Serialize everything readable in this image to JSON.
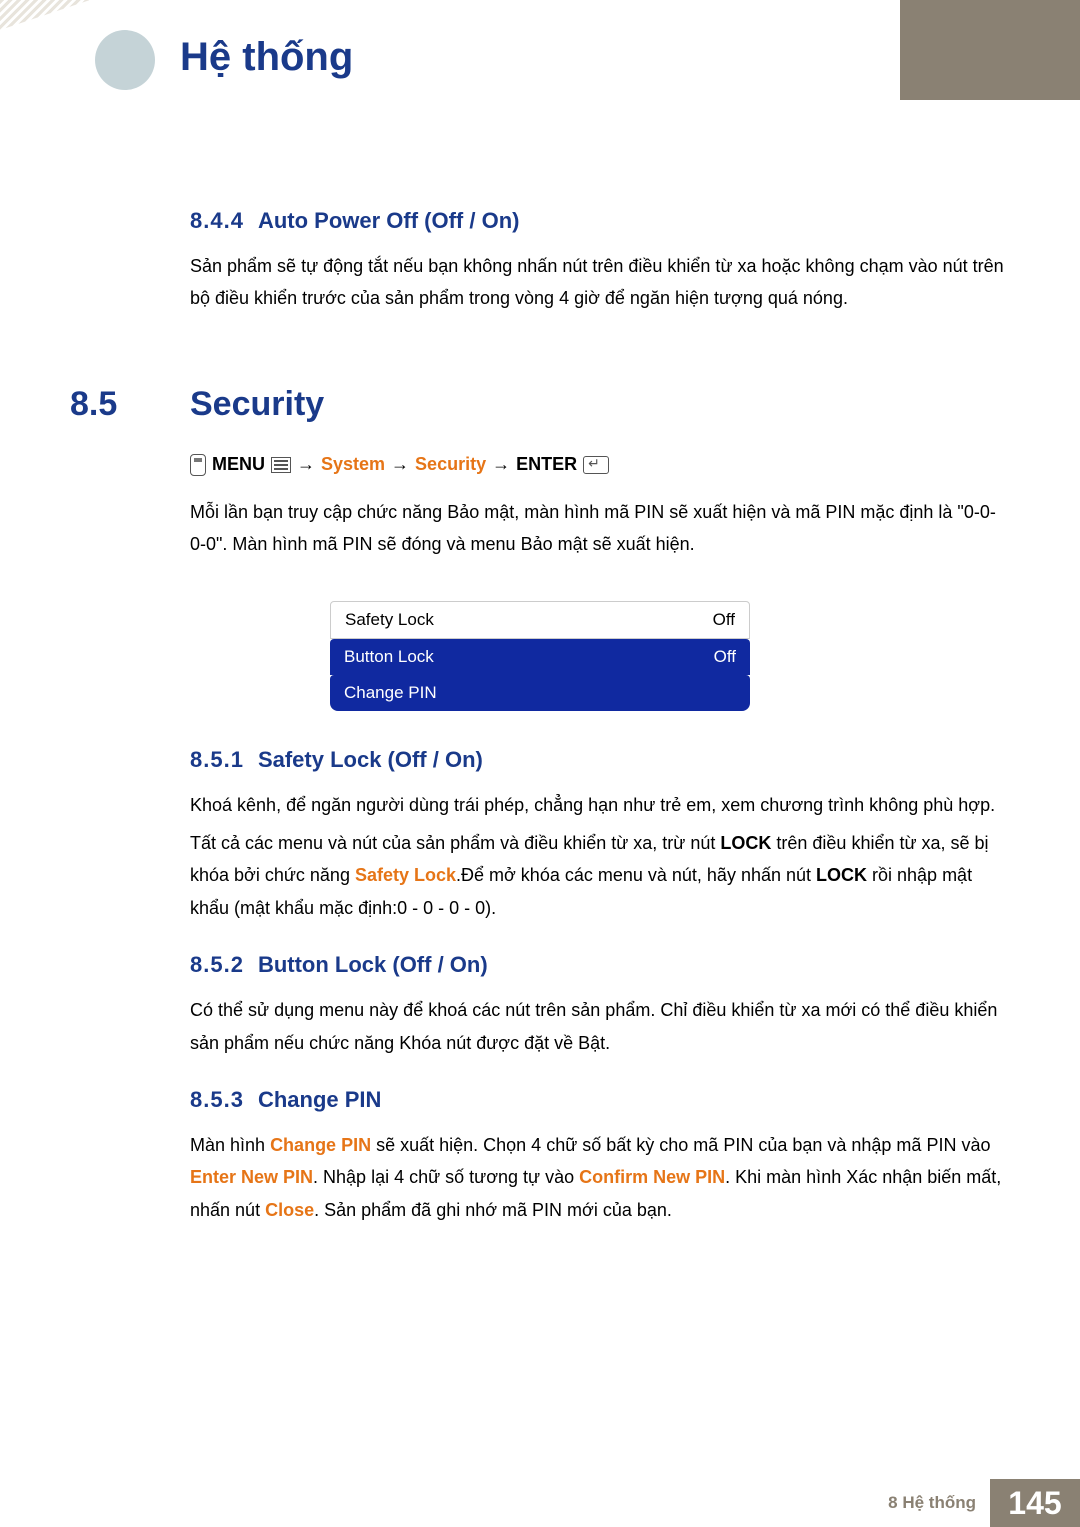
{
  "header": {
    "chapter_title": "Hệ thống"
  },
  "sections": {
    "s844": {
      "num": "8.4.4",
      "title": "Auto Power Off (Off / On)",
      "para": "Sản phẩm sẽ tự động tắt nếu bạn không nhấn nút trên điều khiển từ xa hoặc không chạm vào nút trên bộ điều khiển trước của sản phẩm trong vòng 4 giờ để ngăn hiện tượng quá nóng."
    },
    "s85": {
      "num": "8.5",
      "title": "Security",
      "nav": {
        "menu": "MENU",
        "p1": "System",
        "p2": "Security",
        "enter": "ENTER"
      },
      "para": "Mỗi lần bạn truy cập chức năng Bảo mật, màn hình mã PIN sẽ xuất hiện và mã PIN mặc định là \"0-0-0-0\". Màn hình mã PIN sẽ đóng và menu Bảo mật sẽ xuất hiện.",
      "osd": {
        "rows": [
          {
            "label": "Safety Lock",
            "value": "Off",
            "style": "white"
          },
          {
            "label": "Button Lock",
            "value": "Off",
            "style": "blue"
          },
          {
            "label": "Change PIN",
            "value": "",
            "style": "blue last"
          }
        ]
      }
    },
    "s851": {
      "num": "8.5.1",
      "title": "Safety Lock (Off / On)",
      "para1": "Khoá kênh, để ngăn người dùng trái phép, chẳng hạn như trẻ em, xem chương trình không phù hợp.",
      "para2_a": "Tất cả các menu và nút của sản phẩm và điều khiển từ xa, trừ nút ",
      "para2_lock": "LOCK",
      "para2_b": " trên điều khiển từ xa, sẽ bị khóa bởi chức năng ",
      "para2_safety": "Safety Lock",
      "para2_c": ".Để mở khóa các menu và nút, hãy nhấn nút ",
      "para2_lock2": "LOCK",
      "para2_d": " rồi nhập mật khẩu (mật khẩu mặc định:0 - 0 - 0 - 0)."
    },
    "s852": {
      "num": "8.5.2",
      "title": "Button Lock (Off / On)",
      "para": "Có thể sử dụng menu này để khoá các nút trên sản phẩm. Chỉ điều khiển từ xa mới có thể điều khiển sản phẩm nếu chức năng Khóa nút được đặt về Bật."
    },
    "s853": {
      "num": "8.5.3",
      "title": "Change PIN",
      "p_a": "Màn hình ",
      "p_changepin": "Change PIN",
      "p_b": " sẽ xuất hiện. Chọn 4 chữ số bất kỳ cho mã PIN của bạn và nhập mã PIN vào ",
      "p_enternew": "Enter New PIN",
      "p_c": ". Nhập lại 4 chữ số tương tự vào ",
      "p_confirm": "Confirm New PIN",
      "p_d": ". Khi màn hình Xác nhận biến mất, nhấn nút ",
      "p_close": "Close",
      "p_e": ". Sản phẩm đã ghi nhớ mã PIN mới của bạn."
    }
  },
  "footer": {
    "label": "8 Hệ thống",
    "page": "145"
  }
}
